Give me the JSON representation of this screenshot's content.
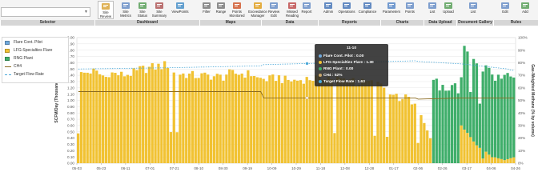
{
  "toolbar": {
    "selector": {
      "value": "",
      "label": "Selector"
    },
    "groups": [
      {
        "label": "Dashboard"
      },
      {
        "label": "Maps"
      },
      {
        "label": "Data"
      },
      {
        "label": "Reports"
      },
      {
        "label": "Charts"
      },
      {
        "label": "Data Upload"
      },
      {
        "label": "Document Gallery"
      },
      {
        "label": "Rules"
      }
    ],
    "buttons": [
      {
        "label": "Site Review",
        "icon": "site-review-icon"
      },
      {
        "label": "Site Metrics",
        "icon": "site-metrics-icon"
      },
      {
        "label": "Site Status",
        "icon": "site-status-icon"
      },
      {
        "label": "Site Summary",
        "icon": "site-summary-icon"
      },
      {
        "label": "ViewPoints",
        "icon": "viewpoints-icon"
      },
      {
        "label": "Filter",
        "icon": "filter-icon"
      },
      {
        "label": "Range",
        "icon": "range-icon"
      },
      {
        "label": "Points Monitored",
        "icon": "points-monitored-icon"
      },
      {
        "label": "Exceedance Manager",
        "icon": "exceedance-icon"
      },
      {
        "label": "Review Edit",
        "icon": "review-edit-icon"
      },
      {
        "label": "Missed Reading",
        "icon": "missed-reading-icon"
      },
      {
        "label": "Report",
        "icon": "report-icon"
      },
      {
        "label": "Admin",
        "icon": "admin-icon"
      },
      {
        "label": "Operations",
        "icon": "operations-icon"
      },
      {
        "label": "Compliance",
        "icon": "compliance-icon"
      },
      {
        "label": "Parameters",
        "icon": "parameters-icon"
      },
      {
        "label": "Points",
        "icon": "points-icon"
      },
      {
        "label": "List",
        "icon": "list-icon"
      },
      {
        "label": "Upload",
        "icon": "upload-icon"
      },
      {
        "label": "List",
        "icon": "list-icon"
      },
      {
        "label": "Edit",
        "icon": "edit-icon"
      },
      {
        "label": "Add",
        "icon": "add-icon"
      }
    ]
  },
  "legend": [
    {
      "label": "Flare Cont. Pilot",
      "color": "#6fa8dc",
      "kind": "box"
    },
    {
      "label": "LFG-Specialties Flare",
      "color": "#f1c232",
      "kind": "box"
    },
    {
      "label": "RNG Plant",
      "color": "#3fae6a",
      "kind": "box"
    },
    {
      "label": "CH4",
      "color": "#8a6a20",
      "kind": "line"
    },
    {
      "label": "Target Flow Rate",
      "color": "#4aa8d8",
      "kind": "dash"
    }
  ],
  "tooltip": {
    "title": "11-10",
    "rows": [
      {
        "label": "Flare Cont. Pilot : 0.00",
        "color": "#6fa8dc"
      },
      {
        "label": "LFG-Specialties Flare : 1.30",
        "color": "#f1c232"
      },
      {
        "label": "RNG Plant : 0.00",
        "color": "#3fae6a"
      },
      {
        "label": "CH4 : 52%",
        "color": "#c9a66b"
      },
      {
        "label": "Target Flow Rate : 1.63",
        "color": "#4aa8d8"
      }
    ]
  },
  "chart_data": {
    "type": "bar",
    "ylabel": "SCFM/Day (Thousands)",
    "y2label": "Gas-Weighted Methane (% by volume)",
    "ylim": [
      0,
      2.0
    ],
    "y2lim": [
      0,
      100
    ],
    "yticks": [
      "0.00",
      "0.10",
      "0.20",
      "0.30",
      "0.40",
      "0.50",
      "0.60",
      "0.70",
      "0.80",
      "0.90",
      "1.00",
      "1.10",
      "1.20",
      "1.30",
      "1.40",
      "1.50",
      "1.60",
      "1.70",
      "1.80",
      "1.90",
      "2.00"
    ],
    "y2ticks": [
      "0%",
      "10%",
      "20%",
      "30%",
      "40%",
      "50%",
      "60%",
      "70%",
      "80%",
      "90%",
      "100%"
    ],
    "xticks": [
      "05-03",
      "05-23",
      "06-11",
      "07-01",
      "07-21",
      "08-10",
      "08-30",
      "09-19",
      "10-09",
      "10-29",
      "11-18",
      "12-08",
      "12-28",
      "01-17",
      "02-06",
      "02-26",
      "03-17",
      "04-06",
      "04-26"
    ],
    "grid": true,
    "series": [
      {
        "name": "LFG-Specialties Flare",
        "color": "#f1c232",
        "segments": [
          [
            0,
            1.43,
            1.5,
            1.4
          ],
          [
            10,
            1.47,
            1.43,
            1.48
          ],
          [
            20,
            1.52,
            1.56,
            1.6
          ],
          [
            30,
            1.47,
            1.45,
            1.43
          ],
          [
            38,
            1.42,
            1.42,
            1.4
          ],
          [
            48,
            1.45,
            1.46,
            1.44
          ],
          [
            58,
            1.38,
            1.36,
            1.4
          ],
          [
            66,
            1.36,
            1.34,
            1.36
          ],
          [
            74,
            1.37,
            1.38,
            1.4
          ],
          [
            82,
            1.38,
            1.36,
            1.37
          ],
          [
            90,
            1.3,
            1.32,
            1.28
          ],
          [
            98,
            1.3,
            1.15,
            1.0
          ],
          [
            106,
            1.1,
            0.9,
            0.4
          ],
          [
            115,
            0.0,
            0.0,
            0.0
          ],
          [
            124,
            0.6,
            0.3,
            0.1
          ],
          [
            135,
            0.1,
            0.05,
            0.1
          ]
        ]
      },
      {
        "name": "RNG Plant",
        "color": "#3fae6a",
        "segments": [
          [
            115,
            1.4,
            1.25,
            1.3
          ],
          [
            124,
            1.35,
            1.3,
            1.38
          ],
          [
            135,
            1.32,
            1.34,
            1.28
          ]
        ]
      },
      {
        "name": "CH4",
        "color": "#8a6a20",
        "segments": [
          [
            0,
            57,
            57,
            57
          ],
          [
            60,
            52,
            52,
            52
          ],
          [
            110,
            51,
            52,
            52
          ],
          [
            140,
            52,
            52,
            52
          ]
        ]
      },
      {
        "name": "Target Flow Rate",
        "color": "#4aa8d8",
        "segments": [
          [
            0,
            1.5,
            1.52,
            1.55
          ],
          [
            60,
            1.57,
            1.6,
            1.63
          ],
          [
            110,
            1.62,
            1.58,
            1.5
          ],
          [
            140,
            1.48,
            1.48,
            1.48
          ]
        ]
      }
    ],
    "points": 142
  }
}
